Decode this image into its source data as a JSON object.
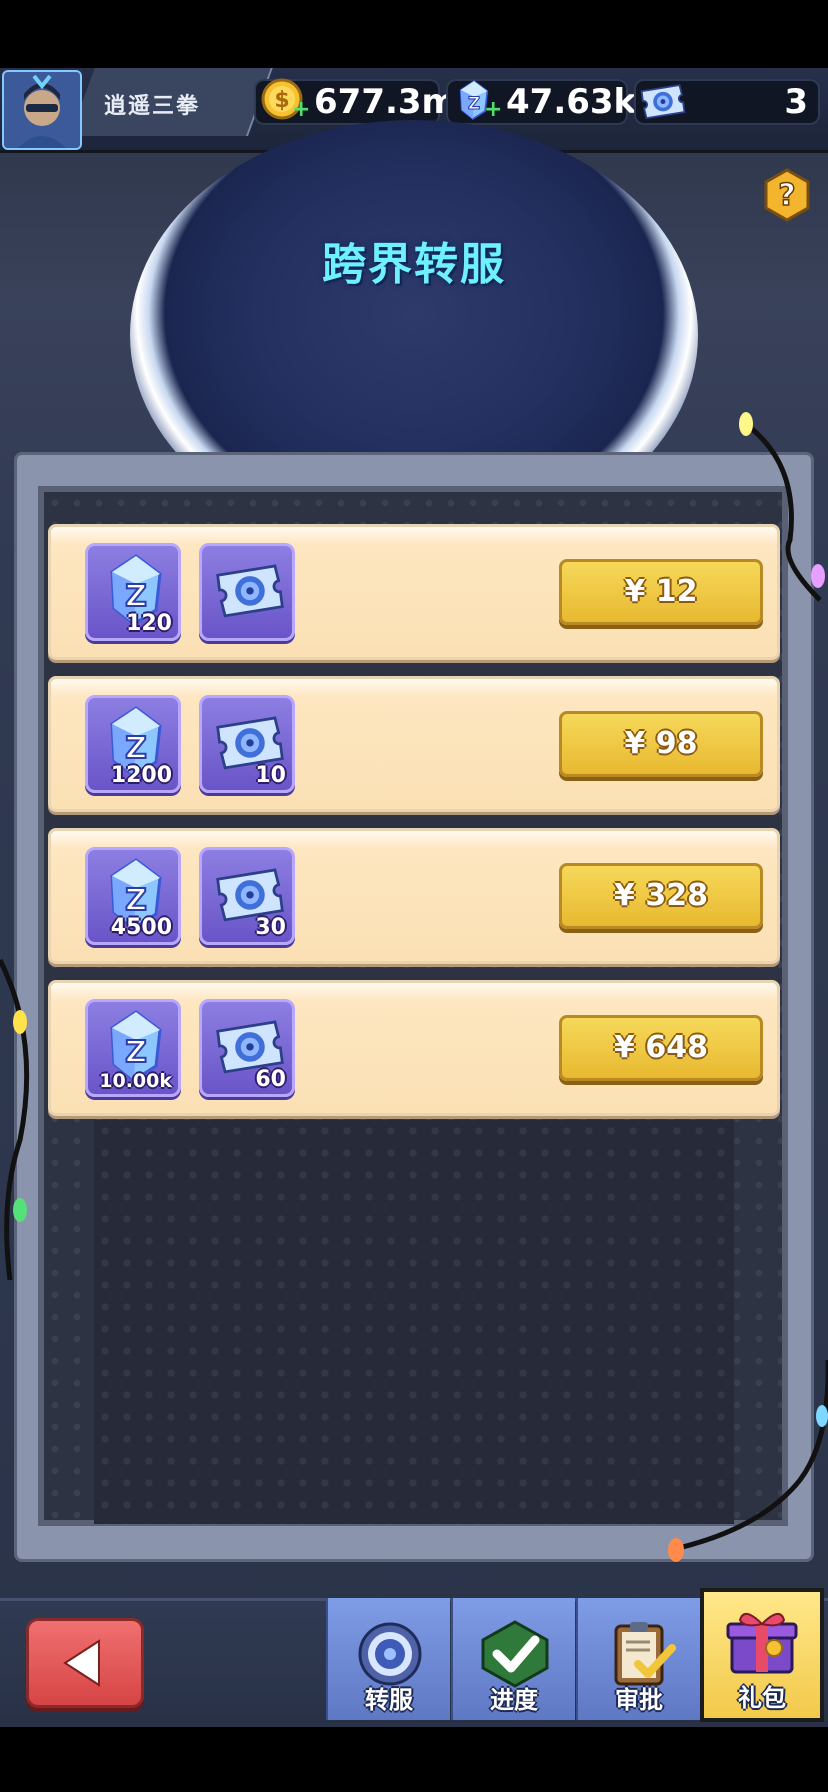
{
  "player": {
    "name": "逍遥三拳"
  },
  "resources": [
    {
      "name": "gold",
      "value": "677.3m",
      "icon": "gold-coin-icon"
    },
    {
      "name": "gem",
      "value": "47.63k",
      "icon": "crystal-gem-icon"
    },
    {
      "name": "ticket",
      "value": "3",
      "icon": "portal-ticket-icon"
    }
  ],
  "page": {
    "title": "跨界转服",
    "help_symbol": "?"
  },
  "packs": [
    {
      "gem_count": "120",
      "ticket_count": "",
      "price": "¥ 12"
    },
    {
      "gem_count": "1200",
      "ticket_count": "10",
      "price": "¥ 98"
    },
    {
      "gem_count": "4500",
      "ticket_count": "30",
      "price": "¥ 328"
    },
    {
      "gem_count": "10.00k",
      "ticket_count": "60",
      "price": "¥ 648"
    }
  ],
  "tabs": [
    {
      "id": "transfer",
      "label": "转服",
      "icon": "portal-icon",
      "active": false
    },
    {
      "id": "progress",
      "label": "进度",
      "icon": "checkmark-icon",
      "active": false
    },
    {
      "id": "approve",
      "label": "审批",
      "icon": "clipboard-icon",
      "active": false
    },
    {
      "id": "gift",
      "label": "礼包",
      "icon": "gift-box-icon",
      "active": true
    }
  ],
  "colors": {
    "accent_title": "#6ef0ff",
    "button_gold": "#e8b930",
    "tab_active": "#f2c94a",
    "back_red": "#d64545"
  }
}
